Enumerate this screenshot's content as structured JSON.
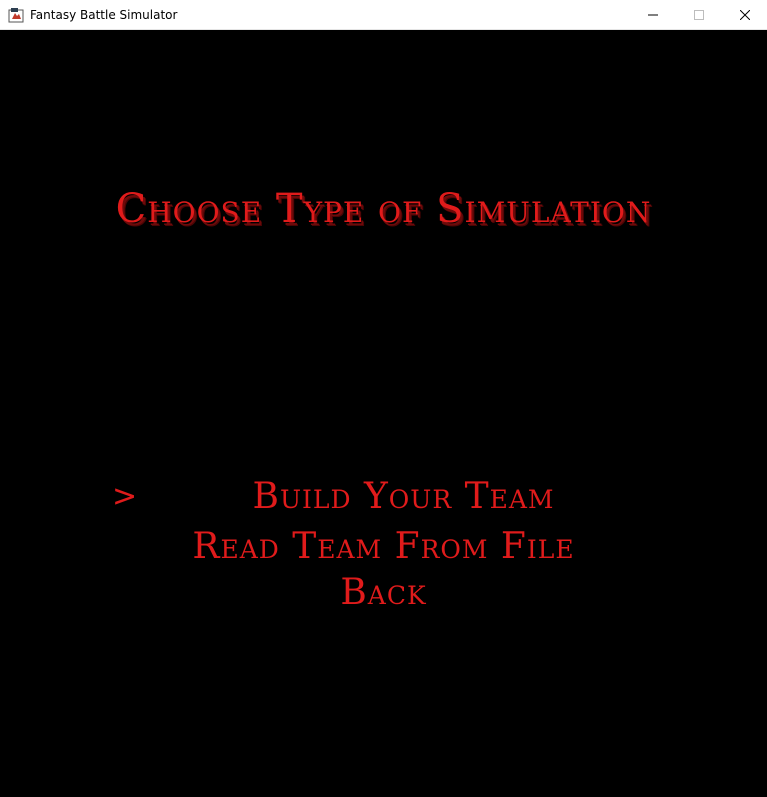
{
  "window": {
    "title": "Fantasy Battle Simulator",
    "icon": "java-app-icon",
    "controls": [
      "minimize-icon",
      "maximize-icon",
      "close-icon"
    ]
  },
  "screen": {
    "heading": "Choose Type of Simulation",
    "cursor": ">",
    "selected_index": 0,
    "menu_items": [
      {
        "label": "Build Your Team"
      },
      {
        "label": "Read Team From File"
      },
      {
        "label": "Back"
      }
    ]
  },
  "colors": {
    "background": "#000000",
    "text": "#e01b1b",
    "text_shadow": "#6e0a0a"
  }
}
